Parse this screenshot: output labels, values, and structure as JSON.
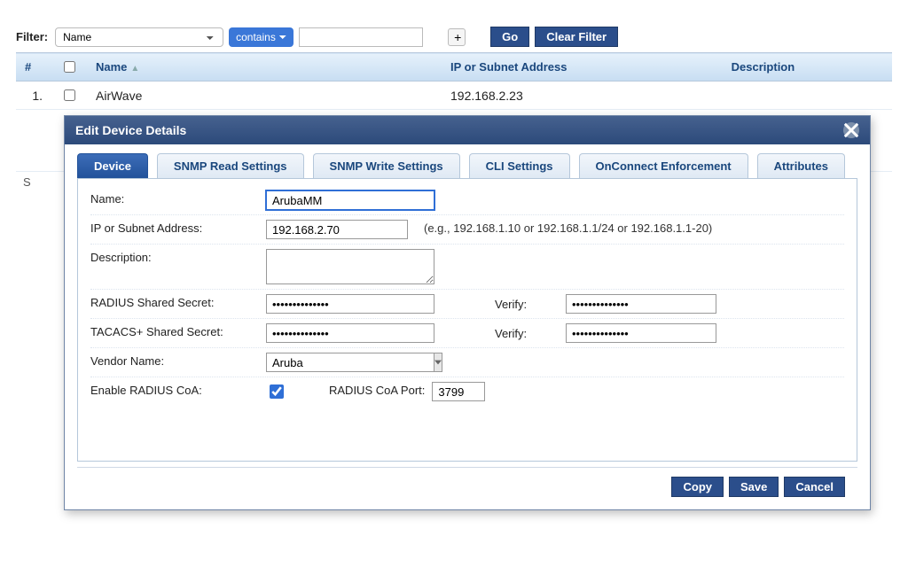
{
  "filter": {
    "label": "Filter:",
    "field_select": "Name",
    "match_select": "contains",
    "value": "",
    "add_label": "+",
    "go_label": "Go",
    "clear_label": "Clear Filter"
  },
  "table": {
    "headers": {
      "num": "#",
      "name": "Name",
      "ip": "IP or Subnet Address",
      "desc": "Description"
    },
    "rows": [
      {
        "num": "1.",
        "name": "AirWave",
        "ip": "192.168.2.23",
        "desc": ""
      }
    ],
    "showing_prefix": "S"
  },
  "modal": {
    "title": "Edit Device Details",
    "tabs": {
      "device": "Device",
      "snmp_read": "SNMP Read Settings",
      "snmp_write": "SNMP Write Settings",
      "cli": "CLI Settings",
      "onconnect": "OnConnect Enforcement",
      "attributes": "Attributes"
    },
    "form": {
      "name_label": "Name:",
      "name_value": "ArubaMM",
      "ip_label": "IP or Subnet Address:",
      "ip_value": "192.168.2.70",
      "ip_hint": "(e.g., 192.168.1.10 or 192.168.1.1/24 or 192.168.1.1-20)",
      "desc_label": "Description:",
      "desc_value": "",
      "radius_label": "RADIUS Shared Secret:",
      "radius_value": "••••••••••••••",
      "radius_verify_label": "Verify:",
      "radius_verify_value": "••••••••••••••",
      "tacacs_label": "TACACS+ Shared Secret:",
      "tacacs_value": "••••••••••••••",
      "tacacs_verify_label": "Verify:",
      "tacacs_verify_value": "••••••••••••••",
      "vendor_label": "Vendor Name:",
      "vendor_value": "Aruba",
      "coa_label": "Enable RADIUS CoA:",
      "coa_port_label": "RADIUS CoA Port:",
      "coa_port_value": "3799"
    },
    "footer": {
      "copy": "Copy",
      "save": "Save",
      "cancel": "Cancel"
    }
  }
}
